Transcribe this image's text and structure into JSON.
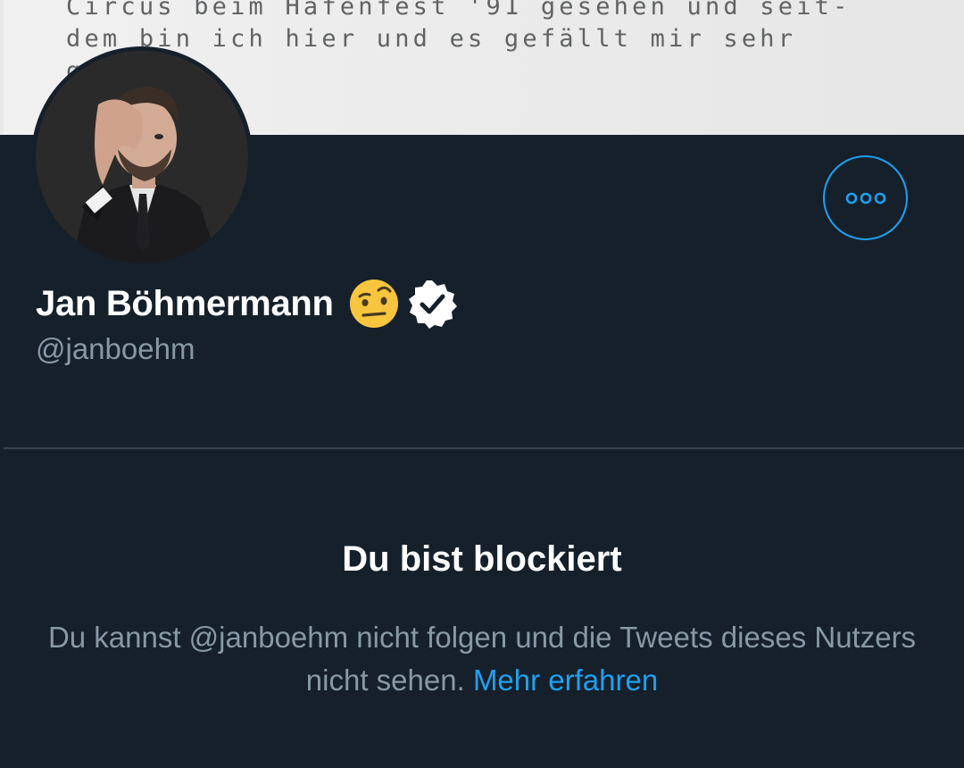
{
  "banner": {
    "lines": [
      "Circus beim Hafenfest '91 gesehen und seit-",
      "dem bin ich hier und es gefällt mir sehr",
      "g"
    ]
  },
  "profile": {
    "name": "Jan Böhmermann",
    "emoji": "face-with-raised-eyebrow",
    "verified": true,
    "handle": "@janboehm"
  },
  "more_button": {
    "icon": "more-dots-icon"
  },
  "blocked": {
    "title": "Du bist blockiert",
    "message": "Du kannst @janboehm nicht folgen und die Tweets dieses Nutzers nicht sehen.",
    "link": "Mehr erfahren"
  },
  "colors": {
    "background": "#15202b",
    "accent": "#1da1f2",
    "secondary_text": "#8899a6",
    "divider": "#38444d"
  }
}
